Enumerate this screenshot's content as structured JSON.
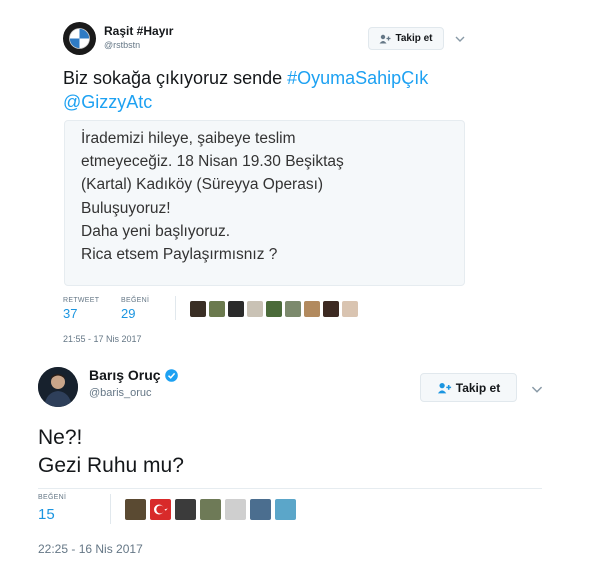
{
  "tweet1": {
    "display_name": "Raşit #Hayır",
    "handle": "@rstbstn",
    "follow_label": "Takip et",
    "text_line1": "Biz sokağa çıkıyoruz sende ",
    "hashtag": "#OyumaSahipÇık",
    "mention": "@GizzyAtc",
    "quote_lines": [
      "İrademizi hileye, şaibeye teslim",
      "etmeyeceğiz. 18 Nisan 19.30 Beşiktaş",
      "(Kartal) Kadıköy (Süreyya Operası)",
      "Buluşuyoruz!",
      "Daha yeni başlıyoruz.",
      "Rica etsem Paylaşırmısnız ?"
    ],
    "retweet_label": "RETWEET",
    "retweet_count": "37",
    "like_label": "BEĞENİ",
    "like_count": "29",
    "timestamp": "21:55 - 17 Nis 2017",
    "liker_colors": [
      "#3a2f25",
      "#6b7a4e",
      "#2b2b2b",
      "#c9c2b5",
      "#4b6b3a",
      "#7c8a6d",
      "#b28a5e",
      "#3d2a22",
      "#d9c4b1"
    ]
  },
  "tweet2": {
    "display_name": "Barış Oruç",
    "handle": "@baris_oruc",
    "follow_label": "Takip et",
    "text_lines": [
      "Ne?!",
      "Gezi Ruhu mu?"
    ],
    "like_label": "BEĞENİ",
    "like_count": "15",
    "timestamp": "22:25 - 16 Nis 2017",
    "liker_colors": [
      "#5a4a32",
      "#d82a2a",
      "#3b3b3b",
      "#6e7a57",
      "#cfcfcf",
      "#4b6e8f",
      "#5ba6c9"
    ]
  },
  "colors": {
    "accent": "#1da1f2",
    "verified": "#1da1f2"
  }
}
